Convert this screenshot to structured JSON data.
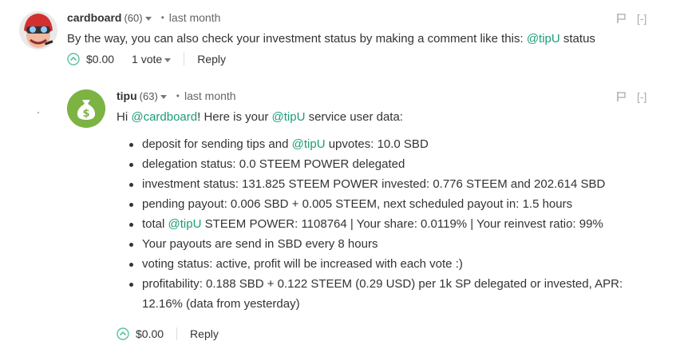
{
  "comment1": {
    "author": "cardboard",
    "reputation": "(60)",
    "separator": "•",
    "time": "last month",
    "collapse": "[-]",
    "text_before": "By the way, you can also check your investment status by making a comment like this: ",
    "mention": "@tipU",
    "text_after": " status",
    "payout": "$0.00",
    "votes": "1 vote",
    "reply": "Reply"
  },
  "comment2": {
    "author": "tipu",
    "reputation": "(63)",
    "separator": "•",
    "time": "last month",
    "collapse": "[-]",
    "greeting": {
      "prefix": "Hi ",
      "mention_user": "@cardboard",
      "middle": "! Here is your ",
      "mention_bot": "@tipU",
      "suffix": " service user data:"
    },
    "bullets": {
      "b1_before": "deposit for sending tips and ",
      "b1_link": "@tipU",
      "b1_after": " upvotes: 10.0 SBD",
      "b2": "delegation status: 0.0 STEEM POWER delegated",
      "b3": "investment status: 131.825 STEEM POWER invested: 0.776 STEEM and 202.614 SBD",
      "b4": "pending payout: 0.006 SBD + 0.005 STEEM, next scheduled payout in: 1.5 hours",
      "b5_before": "total ",
      "b5_link": "@tipU",
      "b5_after": " STEEM POWER: 1108764 | Your share: 0.0119% | Your reinvest ratio: 99%",
      "b6": "Your payouts are send in SBD every 8 hours",
      "b7": "voting status: active, profit will be increased with each vote :)",
      "b8": "profitability: 0.188 SBD + 0.122 STEEM (0.29 USD) per 1k SP delegated or invested, APR: 12.16% (data from yesterday)"
    },
    "payout": "$0.00",
    "reply": "Reply"
  },
  "colors": {
    "link": "#1a9c78",
    "upvote": "#5bbf9e",
    "tipu_avatar": "#7cb342"
  },
  "icons": {
    "upvote": "chevron-up-circle-icon",
    "flag": "flag-icon",
    "money_bag": "money-bag-icon",
    "dropdown": "caret-down-icon"
  }
}
